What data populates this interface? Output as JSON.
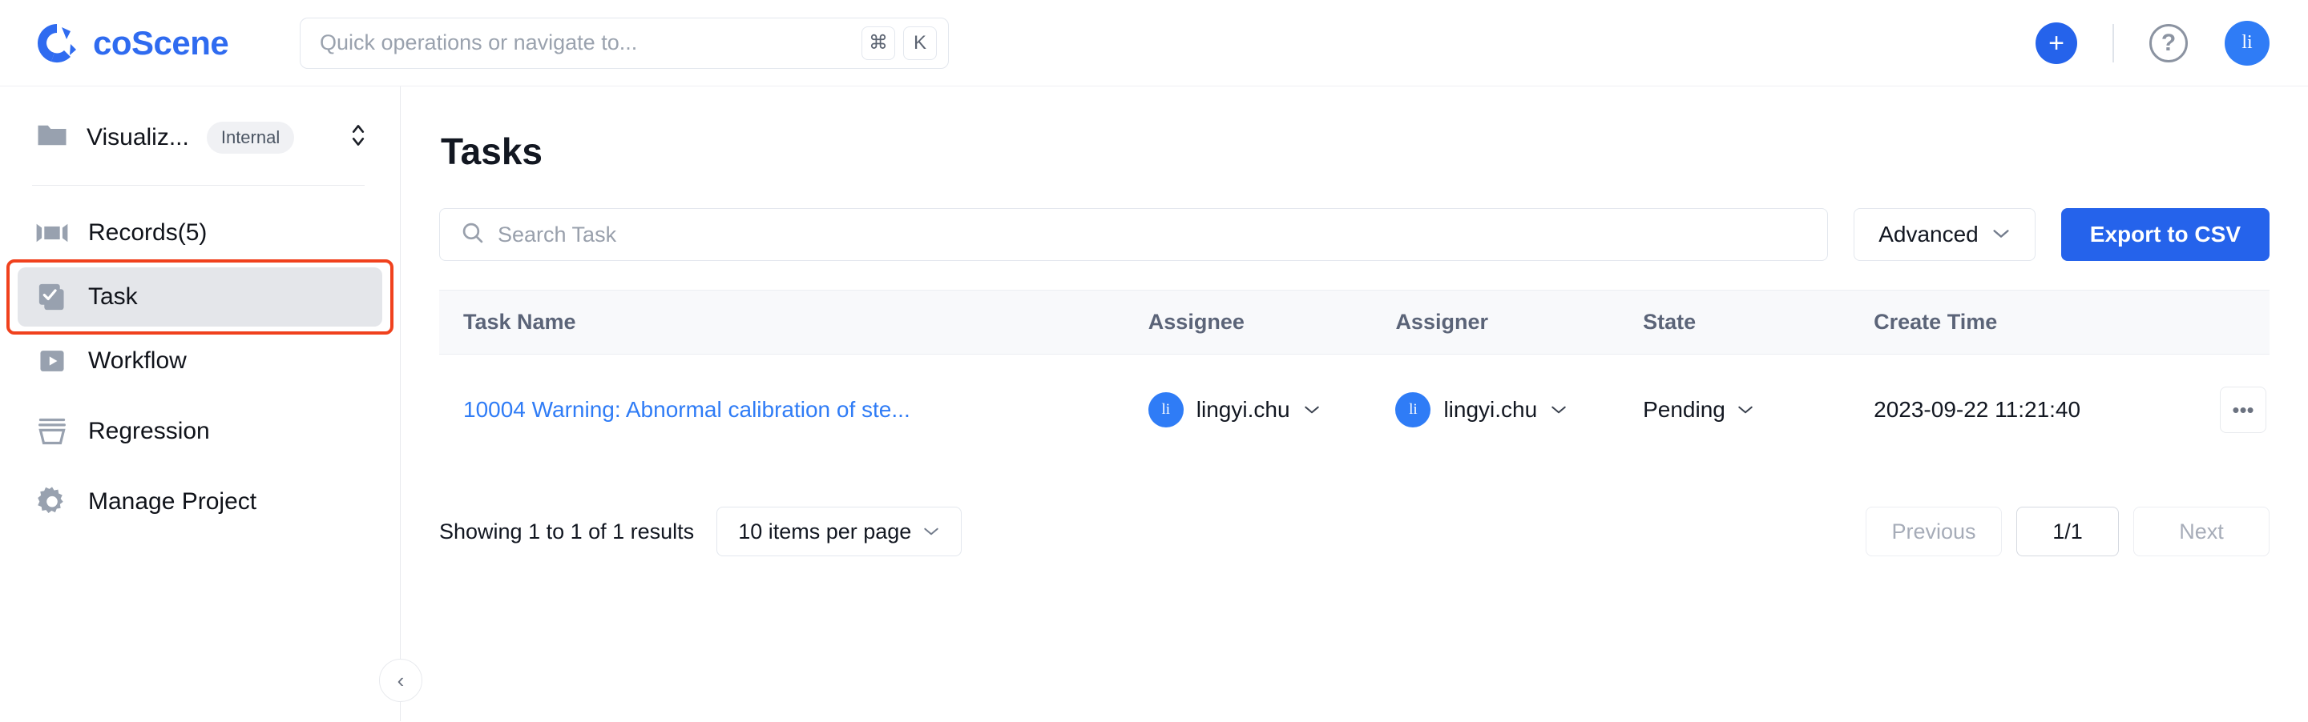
{
  "header": {
    "brand_name": "coScene",
    "brand_logo_icon": "coscene-aperture-logo",
    "omnibox_placeholder": "Quick operations or navigate to...",
    "kbd_cmd": "⌘",
    "kbd_k": "K",
    "add_icon": "plus-icon",
    "help_icon": "question-mark-icon",
    "avatar_initials": "li",
    "accent_color": "#2563eb"
  },
  "sidebar": {
    "project_name": "Visualiz...",
    "project_visibility": "Internal",
    "project_icon": "folder-icon",
    "switch_icon": "up-down-chevron-icon",
    "collapse_icon": "chevron-left-icon",
    "items": [
      {
        "label": "Records(5)",
        "icon": "records-film-icon",
        "active": false
      },
      {
        "label": "Task",
        "icon": "task-checkbox-icon",
        "active": true
      },
      {
        "label": "Workflow",
        "icon": "workflow-play-icon",
        "active": false
      },
      {
        "label": "Regression",
        "icon": "regression-basket-icon",
        "active": false
      },
      {
        "label": "Manage Project",
        "icon": "gear-icon",
        "active": false
      }
    ],
    "highlight_color": "#f0411d"
  },
  "main": {
    "page_title": "Tasks",
    "search_placeholder": "Search Task",
    "search_icon": "search-icon",
    "advanced_label": "Advanced",
    "advanced_icon": "chevron-down-icon",
    "export_label": "Export to CSV"
  },
  "table": {
    "columns": [
      "Task Name",
      "Assignee",
      "Assigner",
      "State",
      "Create Time"
    ],
    "rows": [
      {
        "task_name": "10004 Warning: Abnormal calibration of ste...",
        "assignee": "lingyi.chu",
        "assignee_initials": "li",
        "assigner": "lingyi.chu",
        "assigner_initials": "li",
        "state": "Pending",
        "create_time": "2023-09-22 11:21:40",
        "more_label": "•••"
      }
    ]
  },
  "pagination": {
    "showing_text": "Showing 1 to 1 of 1 results",
    "per_page_label": "10 items per page",
    "previous_label": "Previous",
    "current_page_label": "1/1",
    "next_label": "Next"
  }
}
